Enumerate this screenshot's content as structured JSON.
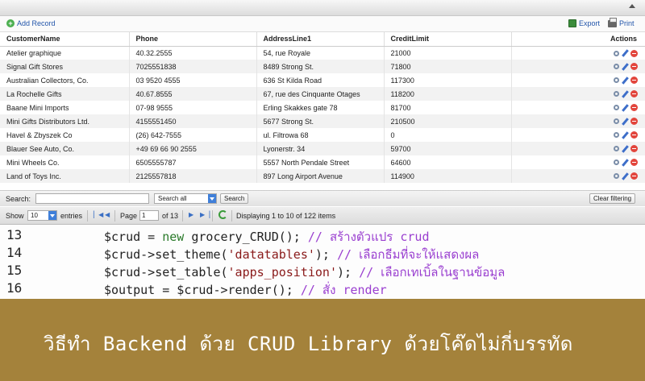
{
  "toolbar": {
    "add_label": "Add Record",
    "export_label": "Export",
    "print_label": "Print"
  },
  "table": {
    "columns": [
      "CustomerName",
      "Phone",
      "AddressLine1",
      "CreditLimit",
      "Actions"
    ],
    "rows": [
      [
        "Atelier graphique",
        "40.32.2555",
        "54, rue Royale",
        "21000"
      ],
      [
        "Signal Gift Stores",
        "7025551838",
        "8489 Strong St.",
        "71800"
      ],
      [
        "Australian Collectors, Co.",
        "03 9520 4555",
        "636 St Kilda Road",
        "117300"
      ],
      [
        "La Rochelle Gifts",
        "40.67.8555",
        "67, rue des Cinquante Otages",
        "118200"
      ],
      [
        "Baane Mini Imports",
        "07-98 9555",
        "Erling Skakkes gate 78",
        "81700"
      ],
      [
        "Mini Gifts Distributors Ltd.",
        "4155551450",
        "5677 Strong St.",
        "210500"
      ],
      [
        "Havel & Zbyszek Co",
        "(26) 642-7555",
        "ul. Filtrowa 68",
        "0"
      ],
      [
        "Blauer See Auto, Co.",
        "+49 69 66 90 2555",
        "Lyonerstr. 34",
        "59700"
      ],
      [
        "Mini Wheels Co.",
        "6505555787",
        "5557 North Pendale Street",
        "64600"
      ],
      [
        "Land of Toys Inc.",
        "2125557818",
        "897 Long Airport Avenue",
        "114900"
      ]
    ]
  },
  "search": {
    "label": "Search:",
    "value": "",
    "field_select": "Search all",
    "search_button": "Search",
    "clear_button": "Clear filtering"
  },
  "pager": {
    "show_label": "Show",
    "per_page": "10",
    "entries_label": "entries",
    "page_label": "Page",
    "page_value": "1",
    "of_label": "of 13",
    "status": "Displaying 1 to 10 of 122 items"
  },
  "code": {
    "lines": [
      {
        "num": "13",
        "var": "$crud",
        "mid": " = ",
        "kw": "new",
        "rest": " grocery_CRUD(); ",
        "comment": "// สร้างตัวแปร crud"
      },
      {
        "num": "14",
        "var": "$crud",
        "mid": "->set_theme(",
        "str": "'datatables'",
        "rest": "); ",
        "comment": "// เลือกธีมที่จะให้แสดงผล"
      },
      {
        "num": "15",
        "var": "$crud",
        "mid": "->set_table(",
        "str": "'apps_position'",
        "rest": "); ",
        "comment": "// เลือกเทเบิ้ลในฐานข้อมูล"
      },
      {
        "num": "16",
        "var": "$output",
        "mid": " = $crud->render(); ",
        "comment": "// สั่ง render"
      }
    ]
  },
  "banner": {
    "text": "วิธีทำ Backend ด้วย CRUD Library ด้วยโค๊ดไม่กี่บรรทัด"
  },
  "colors": {
    "banner_bg": "#a4823b",
    "comment": "#9a3fd0",
    "keyword": "#2a7a2a",
    "string": "#8a1a1a"
  }
}
